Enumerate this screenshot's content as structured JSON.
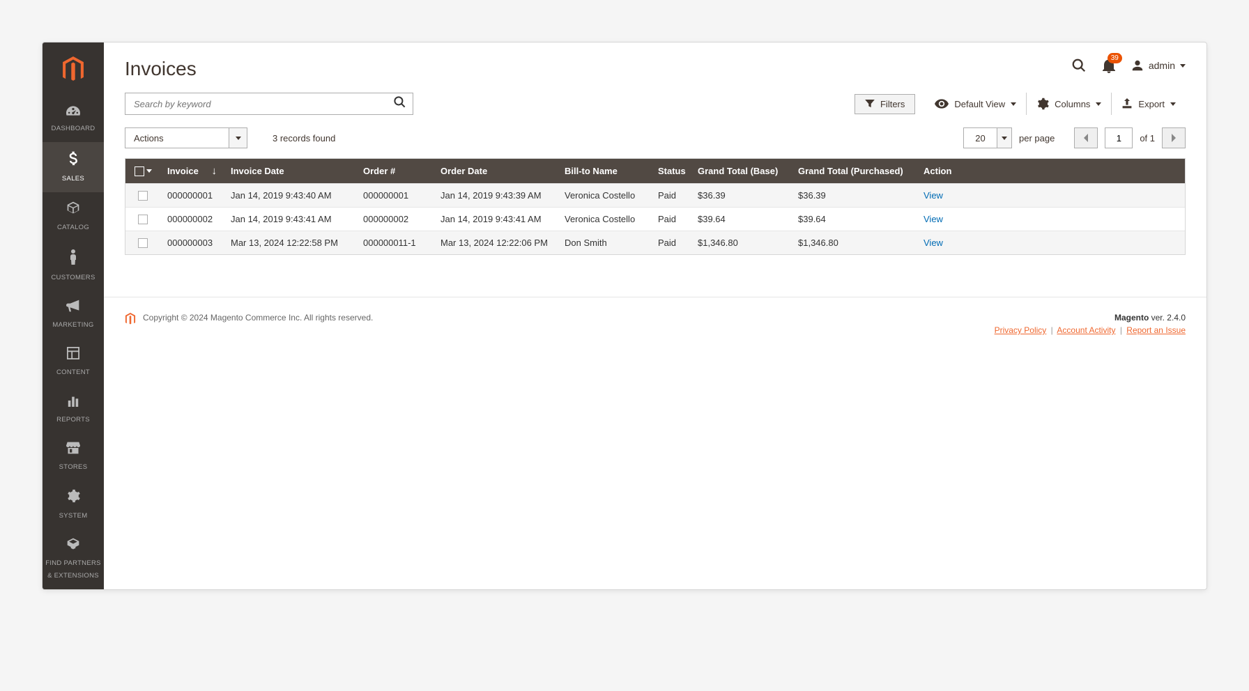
{
  "page": {
    "title": "Invoices"
  },
  "topbar": {
    "notif_count": "39",
    "admin_label": "admin"
  },
  "nav": {
    "items": [
      {
        "label": "DASHBOARD"
      },
      {
        "label": "SALES"
      },
      {
        "label": "CATALOG"
      },
      {
        "label": "CUSTOMERS"
      },
      {
        "label": "MARKETING"
      },
      {
        "label": "CONTENT"
      },
      {
        "label": "REPORTS"
      },
      {
        "label": "STORES"
      },
      {
        "label": "SYSTEM"
      },
      {
        "label": "FIND PARTNERS & EXTENSIONS"
      }
    ]
  },
  "toolbar": {
    "search_placeholder": "Search by keyword",
    "filters_label": "Filters",
    "default_view_label": "Default View",
    "columns_label": "Columns",
    "export_label": "Export",
    "actions_label": "Actions",
    "records_text": "3 records found",
    "per_page_value": "20",
    "per_page_label": "per page",
    "page_value": "1",
    "page_total_label": "of 1"
  },
  "table": {
    "headers": {
      "invoice": "Invoice",
      "invoice_date": "Invoice Date",
      "order": "Order #",
      "order_date": "Order Date",
      "bill_to": "Bill-to Name",
      "status": "Status",
      "gt_base": "Grand Total (Base)",
      "gt_purchased": "Grand Total (Purchased)",
      "action": "Action"
    },
    "rows": [
      {
        "invoice": "000000001",
        "invoice_date": "Jan 14, 2019 9:43:40 AM",
        "order": "000000001",
        "order_date": "Jan 14, 2019 9:43:39 AM",
        "bill_to": "Veronica Costello",
        "status": "Paid",
        "gt_base": "$36.39",
        "gt_purchased": "$36.39",
        "action": "View"
      },
      {
        "invoice": "000000002",
        "invoice_date": "Jan 14, 2019 9:43:41 AM",
        "order": "000000002",
        "order_date": "Jan 14, 2019 9:43:41 AM",
        "bill_to": "Veronica Costello",
        "status": "Paid",
        "gt_base": "$39.64",
        "gt_purchased": "$39.64",
        "action": "View"
      },
      {
        "invoice": "000000003",
        "invoice_date": "Mar 13, 2024 12:22:58 PM",
        "order": "000000011-1",
        "order_date": "Mar 13, 2024 12:22:06 PM",
        "bill_to": "Don Smith",
        "status": "Paid",
        "gt_base": "$1,346.80",
        "gt_purchased": "$1,346.80",
        "action": "View"
      }
    ]
  },
  "footer": {
    "copyright": "Copyright © 2024 Magento Commerce Inc. All rights reserved.",
    "brand": "Magento",
    "version": " ver. 2.4.0",
    "privacy": "Privacy Policy",
    "activity": " Account Activity",
    "report": "Report an Issue"
  }
}
